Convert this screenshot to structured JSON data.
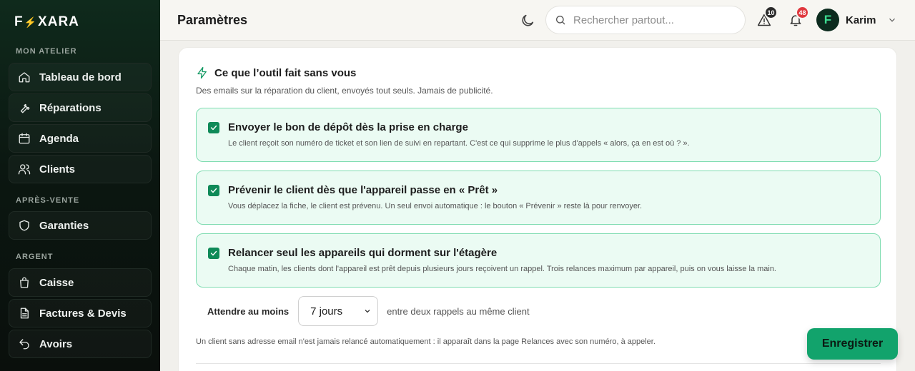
{
  "brand": {
    "name_left": "F",
    "name_right": "XARA",
    "bolt": "⚡"
  },
  "sidebar": {
    "sections": [
      {
        "label": "MON ATELIER",
        "items": [
          {
            "label": "Tableau de bord",
            "icon": "home-icon"
          },
          {
            "label": "Réparations",
            "icon": "wrench-icon"
          },
          {
            "label": "Agenda",
            "icon": "calendar-icon"
          },
          {
            "label": "Clients",
            "icon": "users-icon"
          }
        ]
      },
      {
        "label": "APRÈS-VENTE",
        "items": [
          {
            "label": "Garanties",
            "icon": "shield-icon"
          }
        ]
      },
      {
        "label": "ARGENT",
        "items": [
          {
            "label": "Caisse",
            "icon": "register-icon"
          },
          {
            "label": "Factures & Devis",
            "icon": "document-icon"
          },
          {
            "label": "Avoirs",
            "icon": "undo-icon"
          }
        ]
      }
    ]
  },
  "header": {
    "title": "Paramètres",
    "search_placeholder": "Rechercher partout...",
    "alerts_count": "10",
    "notifications_count": "48",
    "user": {
      "initial": "F",
      "name": "Karim"
    }
  },
  "card": {
    "title": "Ce que l’outil fait sans vous",
    "subtitle": "Des emails sur la réparation du client, envoyés tout seuls. Jamais de publicité.",
    "options": [
      {
        "title": "Envoyer le bon de dépôt dès la prise en charge",
        "desc": "Le client reçoit son numéro de ticket et son lien de suivi en repartant. C'est ce qui supprime le plus d'appels « alors, ça en est où ? ».",
        "checked": true
      },
      {
        "title": "Prévenir le client dès que l'appareil passe en « Prêt »",
        "desc": "Vous déplacez la fiche, le client est prévenu. Un seul envoi automatique : le bouton « Prévenir » reste là pour renvoyer.",
        "checked": true
      },
      {
        "title": "Relancer seul les appareils qui dorment sur l'étagère",
        "desc": "Chaque matin, les clients dont l'appareil est prêt depuis plusieurs jours reçoivent un rappel. Trois relances maximum par appareil, puis on vous laisse la main.",
        "checked": true
      }
    ],
    "wait_label": "Attendre au moins",
    "wait_value": "7 jours",
    "wait_after": "entre deux rappels au même client",
    "footnote": "Un client sans adresse email n'est jamais relancé automatiquement : il apparaît dans la page Relances avec son numéro, à appeler."
  },
  "save_label": "Enregistrer",
  "colors": {
    "accent": "#12a36c",
    "alert_badge": "#2b2b2b",
    "notif_badge": "#e0383e"
  }
}
